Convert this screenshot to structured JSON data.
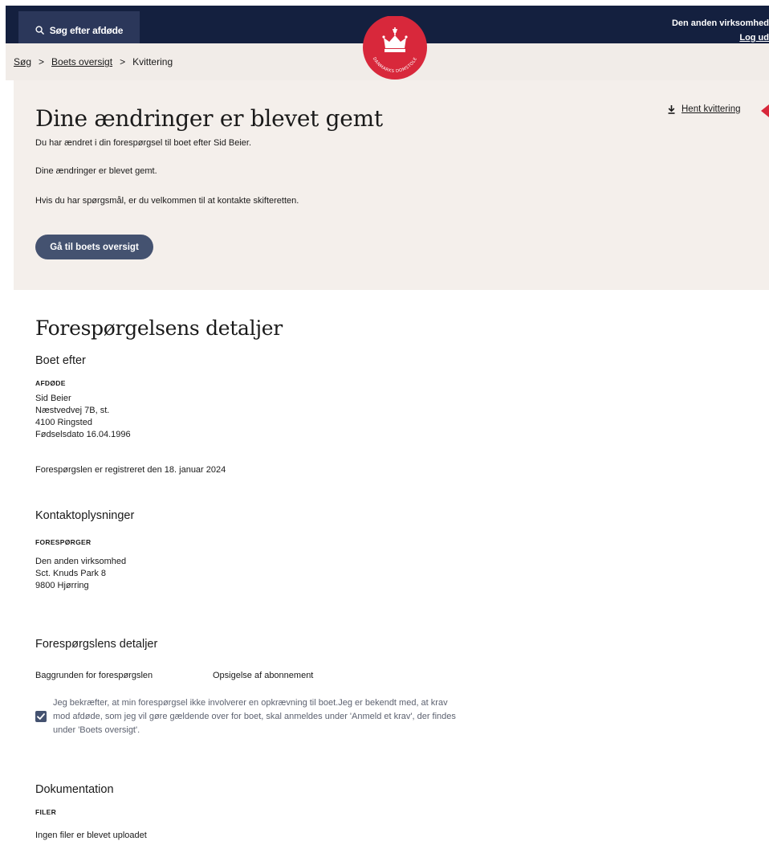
{
  "header": {
    "search_label": "Søg efter afdøde",
    "user_name": "Den anden virksomhed",
    "logout_label": "Log ud",
    "logo_text": "DANMARKS DOMSTOLE"
  },
  "breadcrumb": {
    "items": [
      {
        "label": "Søg",
        "link": true
      },
      {
        "label": "Boets oversigt",
        "link": true
      },
      {
        "label": "Kvittering",
        "link": false
      }
    ],
    "separator": ">"
  },
  "receipt": {
    "title": "Dine ændringer er blevet gemt",
    "line1": "Du har ændret i din forespørgsel til boet efter Sid Beier.",
    "line2": "Dine ændringer er blevet gemt.",
    "line3": "Hvis du har spørgsmål, er du velkommen til at kontakte skifteretten.",
    "button_label": "Gå til boets oversigt",
    "download_label": "Hent kvittering"
  },
  "details": {
    "title": "Forespørgelsens detaljer",
    "estate": {
      "heading": "Boet efter",
      "label": "AFDØDE",
      "name": "Sid Beier",
      "address": "Næstvedvej 7B, st.",
      "city": "4100 Ringsted",
      "birth": "Fødselsdato 16.04.1996",
      "registered": "Forespørgslen er registreret den 18. januar 2024"
    },
    "contact": {
      "heading": "Kontaktoplysninger",
      "label": "FORESPØRGER",
      "name": "Den anden virksomhed",
      "address": "Sct. Knuds Park 8",
      "city": "9800 Hjørring"
    },
    "request": {
      "heading": "Forespørgslens detaljer",
      "reason_key": "Baggrunden for forespørgslen",
      "reason_value": "Opsigelse af abonnement",
      "confirm_line1": "Jeg bekræfter, at min forespørgsel ikke involverer en opkrævning til boet.Jeg er bekendt med, at krav",
      "confirm_line2": "mod afdøde, som jeg vil gøre gældende over for boet, skal anmeldes under 'Anmeld et krav', der findes",
      "confirm_line3": "under 'Boets oversigt'.",
      "checked": true
    },
    "documentation": {
      "heading": "Dokumentation",
      "label": "FILER",
      "empty_text": "Ingen filer er blevet uploadet"
    }
  },
  "colors": {
    "navy": "#14203f",
    "search_bg": "#2b375a",
    "beige": "#f4efeb",
    "button": "#445270",
    "brand_red": "#d8283b"
  }
}
